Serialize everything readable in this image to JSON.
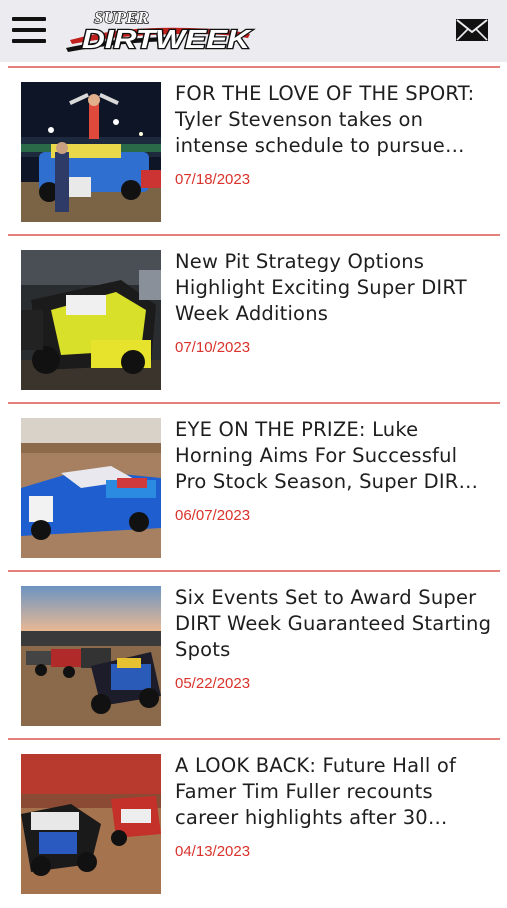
{
  "header": {
    "logo_top": "SUPER",
    "logo_main": "DIRTWEEK",
    "menu_icon": "hamburger-menu-icon",
    "mail_icon": "envelope-icon"
  },
  "articles": [
    {
      "title": "FOR THE LOVE OF THE SPORT: Tyler Stevenson takes on intense schedule to pursue…",
      "date": "07/18/2023"
    },
    {
      "title": "New Pit Strategy Options Highlight Exciting Super DIRT Week Additions",
      "date": "07/10/2023"
    },
    {
      "title": "EYE ON THE PRIZE: Luke Horning Aims For Successful Pro Stock Season, Super DIR…",
      "date": "06/07/2023"
    },
    {
      "title": "Six Events Set to Award Super DIRT Week Guaranteed Starting Spots",
      "date": "05/22/2023"
    },
    {
      "title": "A LOOK BACK: Future Hall of Famer Tim Fuller recounts career highlights after 30…",
      "date": "04/13/2023"
    }
  ],
  "colors": {
    "header_bg": "#ebebf0",
    "divider": "#e3807a",
    "date": "#d9332c",
    "title": "#1e1e1e"
  }
}
